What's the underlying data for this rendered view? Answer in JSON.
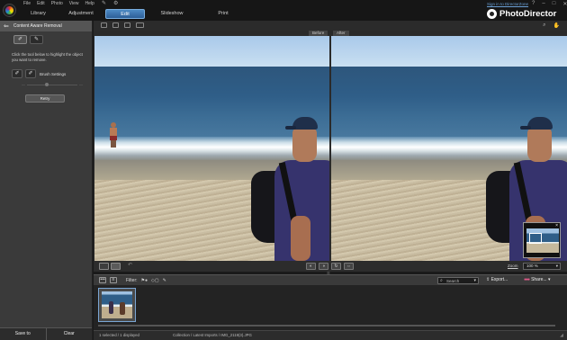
{
  "menu": [
    "File",
    "Edit",
    "Photo",
    "View",
    "Help"
  ],
  "modules": {
    "library": "Library",
    "adjustment": "Adjustment",
    "edit": "Edit",
    "slideshow": "Slideshow",
    "print": "Print"
  },
  "window": {
    "signin": "Sign in to DirectorZone",
    "help": "?",
    "minimize": "–",
    "maximize": "□",
    "close": "✕"
  },
  "brand": "PhotoDirector",
  "panel": {
    "back": "⇐",
    "title": "Content Aware Removal",
    "description": "Click the tool below to highlight the object you want to remove.",
    "brush_settings": "Brush Settings",
    "slider_min": "—",
    "slider_max": "—",
    "retry": "Retry",
    "save_to": "Save to",
    "clear": "Clear"
  },
  "viewer": {
    "before_label": "Before",
    "after_label": "After",
    "zoom_label": "Zoom",
    "zoom_value": "100 %",
    "dropdown_arrow": "▾"
  },
  "browser": {
    "filter_label": "Filter:",
    "filter_flags": "⚑●",
    "filter_shapes": "◇▢",
    "filter_pen": "✎",
    "search_placeholder": "Search",
    "export_label": "Export...",
    "share_label": "Share...",
    "share_dots": "●●●",
    "status_selected": "1 selected / 1 displayed",
    "status_path": "Collection / Latest Imports / IMG_2119(3).JPG"
  },
  "icons": {
    "logo": "photodirector-logo-icon",
    "zoom_tool": "magnifier-icon",
    "pan_tool": "hand-icon",
    "colors": {
      "accent": "#2d5f98",
      "panel": "#3a3a3a",
      "background": "#1a1a1a"
    }
  }
}
